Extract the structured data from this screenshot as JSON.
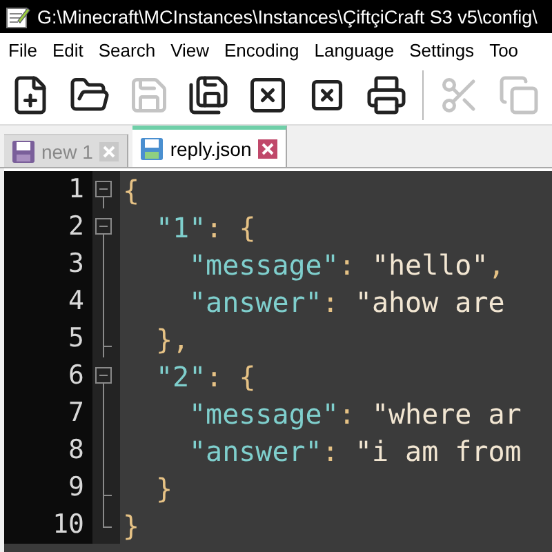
{
  "window": {
    "title": "G:\\Minecraft\\MCInstances\\Instances\\ÇiftçiCraft S3 v5\\config\\"
  },
  "menu": [
    "File",
    "Edit",
    "Search",
    "View",
    "Encoding",
    "Language",
    "Settings",
    "Too"
  ],
  "toolbar": [
    {
      "kind": "new",
      "disabled": false
    },
    {
      "kind": "open",
      "disabled": false
    },
    {
      "kind": "save",
      "disabled": true
    },
    {
      "kind": "save_all",
      "disabled": false
    },
    {
      "kind": "close",
      "disabled": false
    },
    {
      "kind": "close_all",
      "disabled": false
    },
    {
      "kind": "print",
      "disabled": false
    },
    {
      "kind": "separator"
    },
    {
      "kind": "cut",
      "disabled": true
    },
    {
      "kind": "copy",
      "disabled": true
    }
  ],
  "tabs": [
    {
      "label": "new 1",
      "selected": false
    },
    {
      "label": "reply.json",
      "selected": true
    }
  ],
  "editor": {
    "lines": [
      {
        "number": "1",
        "expanded": true,
        "tokens": [
          {
            "kind": "punct",
            "text": "{"
          }
        ],
        "children": [
          {
            "number": "2",
            "expanded": true,
            "tokens": [
              {
                "kind": "key",
                "text": "\"1\""
              },
              {
                "kind": "punct",
                "text": ": {"
              }
            ],
            "children": [
              {
                "number": "3",
                "tokens": [
                  {
                    "kind": "key",
                    "text": "\"message\""
                  },
                  {
                    "kind": "punct",
                    "text": ": "
                  },
                  {
                    "kind": "value",
                    "text": "\"hello\""
                  },
                  {
                    "kind": "punct",
                    "text": ","
                  }
                ]
              },
              {
                "number": "4",
                "tokens": [
                  {
                    "kind": "key",
                    "text": "\"answer\""
                  },
                  {
                    "kind": "punct",
                    "text": ": "
                  },
                  {
                    "kind": "value",
                    "text": "\"ahow are"
                  }
                ]
              }
            ]
          },
          {
            "number": "5",
            "tokens": [
              {
                "kind": "punct",
                "text": "},"
              }
            ]
          },
          {
            "number": "6",
            "expanded": true,
            "tokens": [
              {
                "kind": "key",
                "text": "\"2\""
              },
              {
                "kind": "punct",
                "text": ": {"
              }
            ],
            "children": [
              {
                "number": "7",
                "tokens": [
                  {
                    "kind": "key",
                    "text": "\"message\""
                  },
                  {
                    "kind": "punct",
                    "text": ": "
                  },
                  {
                    "kind": "value",
                    "text": "\"where ar"
                  }
                ]
              },
              {
                "number": "8",
                "tokens": [
                  {
                    "kind": "key",
                    "text": "\"answer\""
                  },
                  {
                    "kind": "punct",
                    "text": ": "
                  },
                  {
                    "kind": "value",
                    "text": "\"i am from"
                  }
                ]
              }
            ]
          },
          {
            "number": "9",
            "tokens": [
              {
                "kind": "punct",
                "text": "}"
              }
            ]
          }
        ]
      },
      {
        "number": "10",
        "tokens": [
          {
            "kind": "punct",
            "text": "}"
          }
        ]
      }
    ]
  }
}
